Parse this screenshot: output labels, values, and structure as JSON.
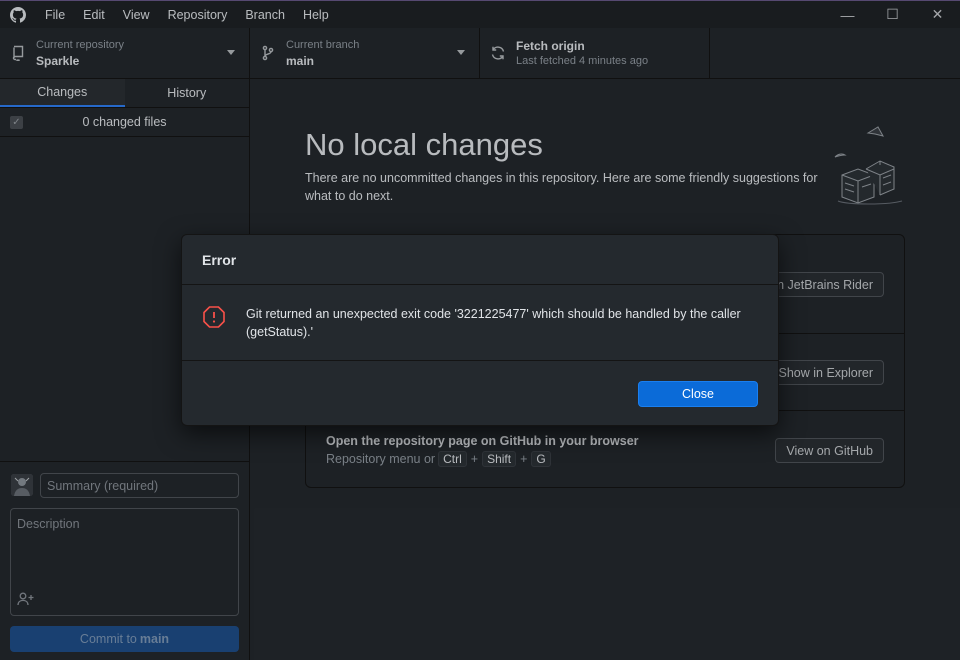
{
  "menu": [
    "File",
    "Edit",
    "View",
    "Repository",
    "Branch",
    "Help"
  ],
  "window_controls": {
    "minimize": "—",
    "maximize": "☐",
    "close": "✕"
  },
  "toolbar": {
    "repo": {
      "label": "Current repository",
      "value": "Sparkle"
    },
    "branch": {
      "label": "Current branch",
      "value": "main"
    },
    "fetch": {
      "label": "Fetch origin",
      "value": "Last fetched 4 minutes ago"
    }
  },
  "sidebar": {
    "tabs": [
      "Changes",
      "History"
    ],
    "changes_count": "0 changed files",
    "summary_placeholder": "Summary (required)",
    "description_placeholder": "Description",
    "commit_prefix": "Commit to",
    "commit_branch": "main"
  },
  "main": {
    "title": "No local changes",
    "subtitle": "There are no uncommitted changes in this repository. Here are some friendly suggestions for what to do next.",
    "suggestions": [
      {
        "button": "in JetBrains Rider"
      },
      {
        "button": "Show in Explorer"
      },
      {
        "title": "Open the repository page on GitHub in your browser",
        "desc_prefix": "Repository menu or",
        "keys": [
          "Ctrl",
          "Shift",
          "G"
        ],
        "button": "View on GitHub"
      }
    ]
  },
  "dialog": {
    "title": "Error",
    "message": "Git returned an unexpected exit code '3221225477' which should be handled by the caller (getStatus).'",
    "close_label": "Close"
  },
  "colors": {
    "accent": "#0b6bd8",
    "error": "#f85149",
    "background": "#24292e"
  }
}
